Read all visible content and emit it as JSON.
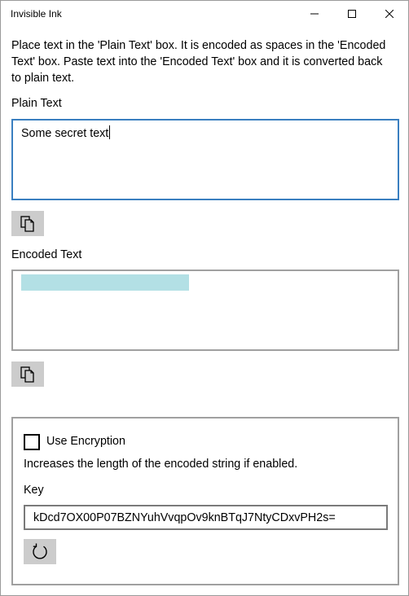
{
  "window": {
    "title": "Invisible Ink"
  },
  "controls": {
    "minimize_icon": "minimize-icon",
    "maximize_icon": "maximize-icon",
    "close_icon": "close-icon"
  },
  "description": "Place text in the 'Plain Text' box.  It is encoded as spaces in the 'Encoded Text' box.  Paste text into the 'Encoded Text' box and it is converted back to plain text.",
  "plain": {
    "label": "Plain Text",
    "value": "Some secret text",
    "copy_icon": "copy-icon"
  },
  "encoded": {
    "label": "Encoded Text",
    "copy_icon": "copy-icon"
  },
  "encryption": {
    "checkbox_label": "Use Encryption",
    "checked": false,
    "hint": "Increases the length of the encoded string if enabled.",
    "key_label": "Key",
    "key_value": "kDcd7OX00P07BZNYuhVvqpOv9knBTqJ7NtyCDxvPH2s=",
    "refresh_icon": "refresh-icon"
  },
  "colors": {
    "focus_border": "#3a7fc0",
    "selection": "#b3e0e5",
    "button_bg": "#cccccc"
  }
}
